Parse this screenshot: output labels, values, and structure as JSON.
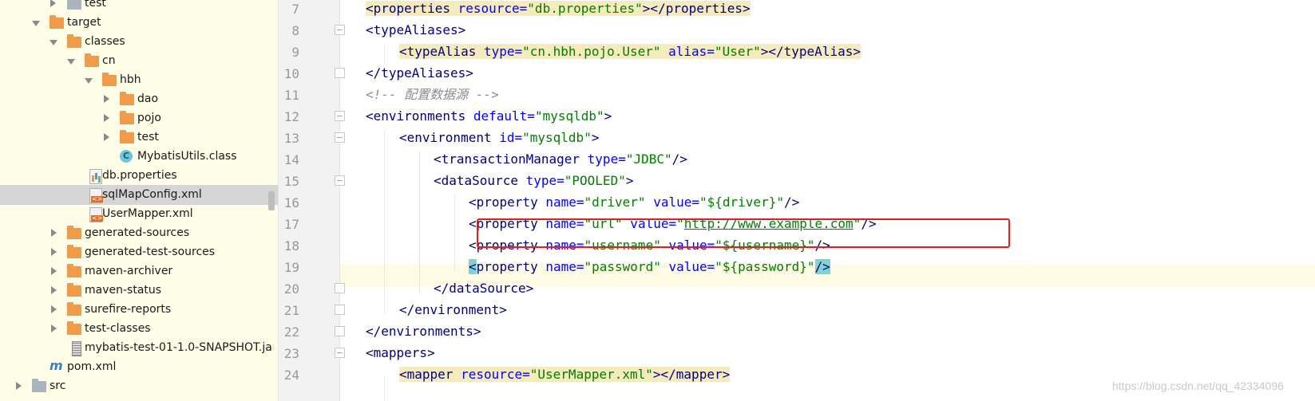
{
  "project_tree": {
    "items": [
      {
        "label": "test",
        "icon": "folder-grey-icon"
      },
      {
        "label": "target",
        "icon": "folder-icon"
      },
      {
        "label": "classes",
        "icon": "folder-icon"
      },
      {
        "label": "cn",
        "icon": "folder-icon"
      },
      {
        "label": "hbh",
        "icon": "folder-icon"
      },
      {
        "label": "dao",
        "icon": "folder-icon"
      },
      {
        "label": "pojo",
        "icon": "folder-icon"
      },
      {
        "label": "test",
        "icon": "folder-icon"
      },
      {
        "label": "MybatisUtils.class",
        "icon": "class-icon",
        "badge": "C"
      },
      {
        "label": "db.properties",
        "icon": "properties-file-icon"
      },
      {
        "label": "sqlMapConfig.xml",
        "icon": "xml-file-icon"
      },
      {
        "label": "UserMapper.xml",
        "icon": "xml-file-icon"
      },
      {
        "label": "generated-sources",
        "icon": "folder-icon"
      },
      {
        "label": "generated-test-sources",
        "icon": "folder-icon"
      },
      {
        "label": "maven-archiver",
        "icon": "folder-icon"
      },
      {
        "label": "maven-status",
        "icon": "folder-icon"
      },
      {
        "label": "surefire-reports",
        "icon": "folder-icon"
      },
      {
        "label": "test-classes",
        "icon": "folder-icon"
      },
      {
        "label": "mybatis-test-01-1.0-SNAPSHOT.ja",
        "icon": "jar-icon"
      },
      {
        "label": "pom.xml",
        "icon": "maven-icon",
        "badge": "m"
      },
      {
        "label": "src",
        "icon": "folder-grey-icon"
      }
    ]
  },
  "editor": {
    "line_numbers": [
      "7",
      "8",
      "9",
      "10",
      "11",
      "12",
      "13",
      "14",
      "15",
      "16",
      "17",
      "18",
      "19",
      "20",
      "21",
      "22",
      "23",
      "24"
    ],
    "lines": {
      "l7": {
        "tag_open": "<properties",
        "attr": " resource=",
        "val": "\"db.properties\"",
        "tag_mid": "></properties>"
      },
      "l8": {
        "tag": "<typeAliases>"
      },
      "l9": {
        "tag_open": "<typeAlias",
        "attr1": " type=",
        "val1": "\"cn.hbh.pojo.User\"",
        "attr2": " alias=",
        "val2": "\"User\"",
        "tag_mid": "></typeAlias>"
      },
      "l10": {
        "tag": "</typeAliases>"
      },
      "l11": {
        "comment": "<!-- 配置数据源 -->"
      },
      "l12": {
        "tag_open": "<environments",
        "attr": " default=",
        "val": "\"mysqldb\"",
        "tag_close": ">"
      },
      "l13": {
        "tag_open": "<environment",
        "attr": " id=",
        "val": "\"mysqldb\"",
        "tag_close": ">"
      },
      "l14": {
        "tag_open": "<transactionManager",
        "attr": " type=",
        "val": "\"JDBC\"",
        "tag_close": "/>"
      },
      "l15": {
        "tag_open": "<dataSource",
        "attr": " type=",
        "val": "\"POOLED\"",
        "tag_close": ">"
      },
      "l16": {
        "tag_open": "<property",
        "attr1": " name=",
        "val1": "\"driver\"",
        "attr2": " value=",
        "val2": "\"${driver}\"",
        "tag_close": "/>"
      },
      "l17": {
        "tag_open": "<property",
        "attr1": " name=",
        "val1": "\"url\"",
        "attr2": " value=",
        "q1": "\"",
        "link": "http://www.example.com",
        "q2": "\"",
        "tag_close": "/>"
      },
      "l18": {
        "tag_open": "<property",
        "attr1": " name=",
        "val1": "\"username\"",
        "attr2": " value=",
        "val2": "\"${username}\"",
        "tag_close": "/>"
      },
      "l19": {
        "lt": "<",
        "tag_open": "property",
        "attr1": " name=",
        "val1": "\"password\"",
        "attr2": " value=",
        "val2": "\"${password}\"",
        "tag_close": "/>"
      },
      "l20": {
        "tag": "</dataSource>"
      },
      "l21": {
        "tag": "</environment>"
      },
      "l22": {
        "tag": "</environments>"
      },
      "l23": {
        "tag": "<mappers>"
      },
      "l24": {
        "tag_open": "<mapper",
        "attr": " resource=",
        "val": "\"UserMapper.xml\"",
        "tag_mid": "></mapper>"
      }
    }
  },
  "watermark": "https://blog.csdn.net/qq_42334096",
  "colors": {
    "tag": "#000080",
    "attribute": "#0000ff",
    "value": "#008000",
    "highlight_box": "#e02020"
  }
}
